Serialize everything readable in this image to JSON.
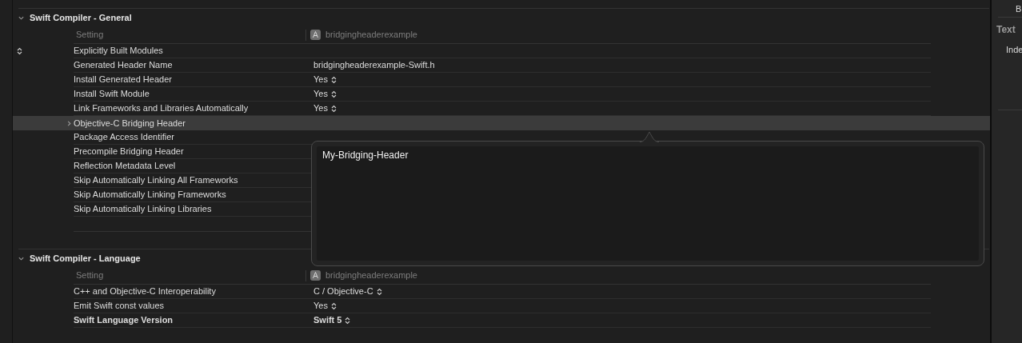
{
  "sections": [
    {
      "title": "Swift Compiler - General",
      "expanded": true,
      "setting_header": "Setting",
      "target": "bridgingheaderexample",
      "rows": [
        {
          "label": "Explicitly Built Modules",
          "kind": "stepper",
          "selected": false,
          "bold": false
        },
        {
          "label": "Generated Header Name",
          "kind": "text",
          "value": "bridgingheaderexample-Swift.h",
          "selected": false,
          "bold": false
        },
        {
          "label": "Install Generated Header",
          "kind": "popup",
          "value": "Yes",
          "selected": false,
          "bold": false
        },
        {
          "label": "Install Swift Module",
          "kind": "popup",
          "value": "Yes",
          "selected": false,
          "bold": false
        },
        {
          "label": "Link Frameworks and Libraries Automatically",
          "kind": "popup",
          "value": "Yes",
          "selected": false,
          "bold": false
        },
        {
          "label": "Objective-C Bridging Header",
          "kind": "disclosure",
          "selected": true,
          "bold": false
        },
        {
          "label": "Package Access Identifier",
          "kind": "empty",
          "selected": false,
          "bold": false
        },
        {
          "label": "Precompile Bridging Header",
          "kind": "empty",
          "selected": false,
          "bold": false
        },
        {
          "label": "Reflection Metadata Level",
          "kind": "empty",
          "selected": false,
          "bold": false
        },
        {
          "label": "Skip Automatically Linking All Frameworks",
          "kind": "empty",
          "selected": false,
          "bold": false
        },
        {
          "label": "Skip Automatically Linking Frameworks",
          "kind": "empty",
          "selected": false,
          "bold": false
        },
        {
          "label": "Skip Automatically Linking Libraries",
          "kind": "empty",
          "selected": false,
          "bold": false
        }
      ]
    },
    {
      "title": "Swift Compiler - Language",
      "expanded": true,
      "setting_header": "Setting",
      "target": "bridgingheaderexample",
      "rows": [
        {
          "label": "C++ and Objective-C Interoperability",
          "kind": "popup",
          "value": "C / Objective-C",
          "selected": false,
          "bold": false
        },
        {
          "label": "Emit Swift const values",
          "kind": "popup",
          "value": "Yes",
          "selected": false,
          "bold": false
        },
        {
          "label": "Swift Language Version",
          "kind": "popup",
          "value": "Swift 5",
          "selected": false,
          "bold": true
        }
      ]
    }
  ],
  "popover": {
    "value": "My-Bridging-Header"
  },
  "inspector": {
    "top_label": "B",
    "section_title": "Text",
    "item_label": "Inde"
  }
}
